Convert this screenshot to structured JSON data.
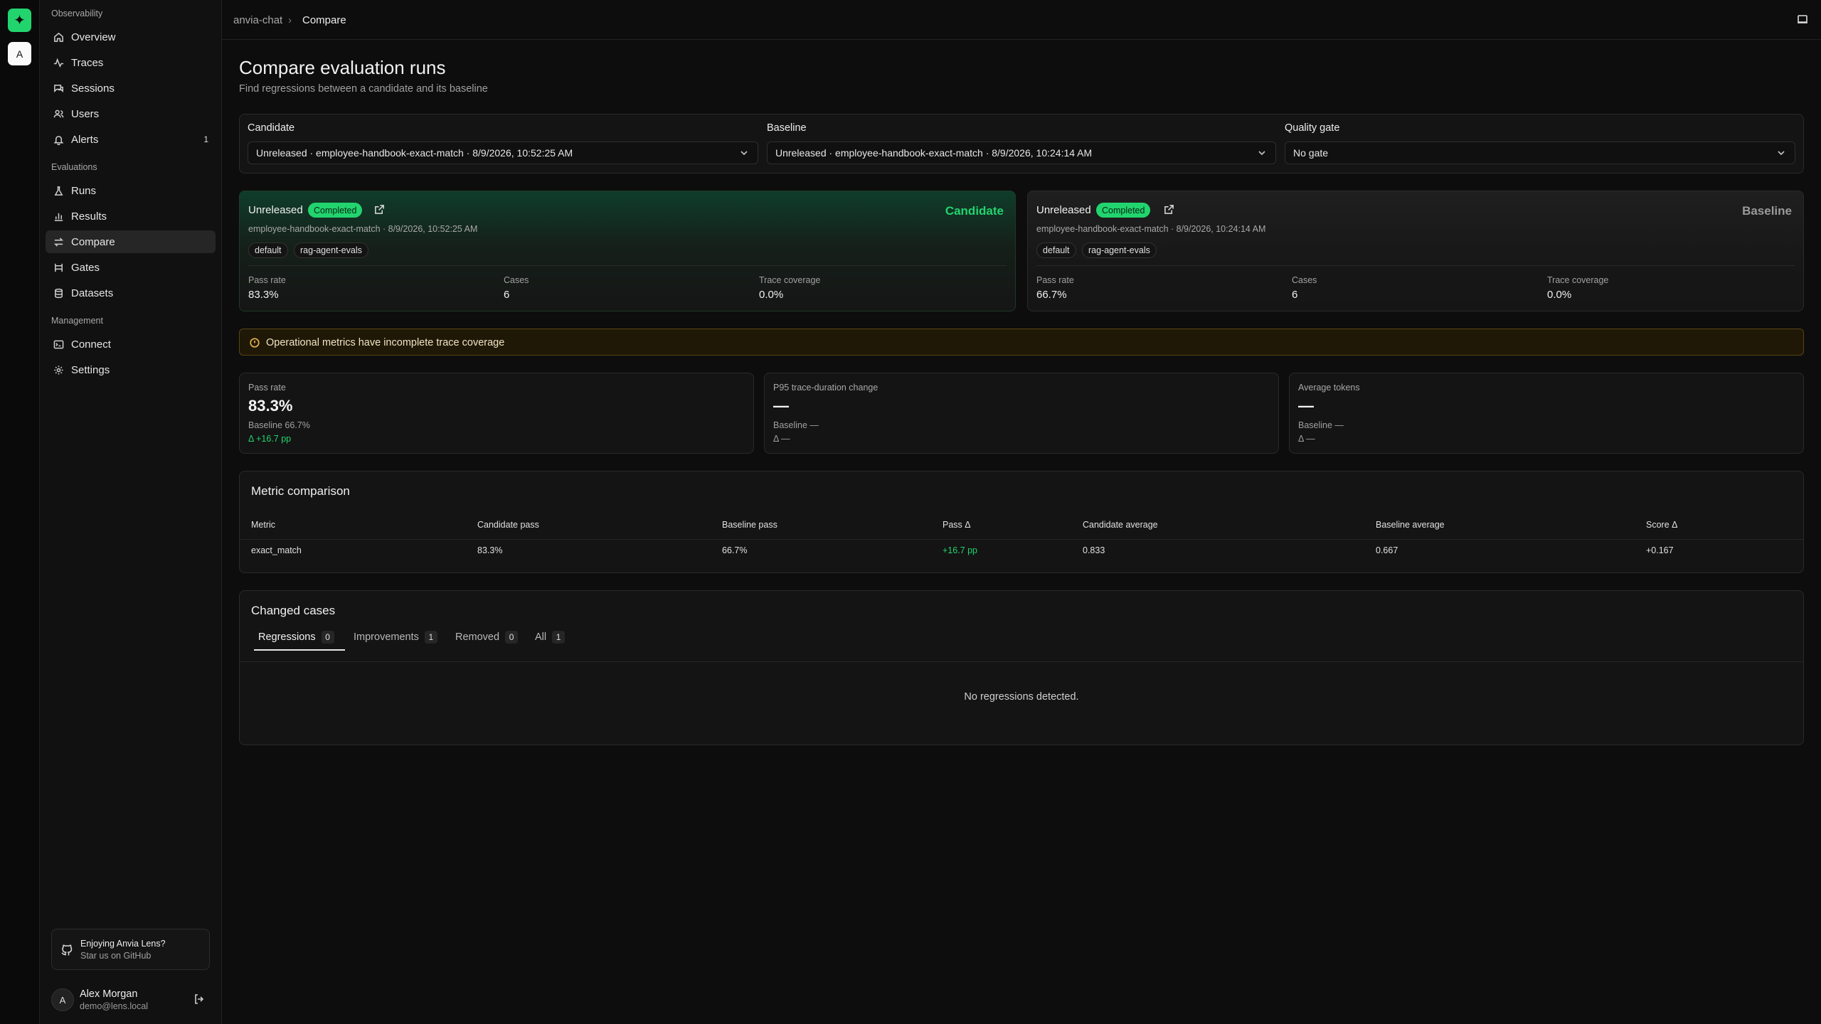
{
  "app": {
    "logo_glyph": "✦",
    "workspace_initial": "A",
    "accent": "#22d46e"
  },
  "sidebar": {
    "groups": [
      {
        "label": "Observability"
      },
      {
        "label": "Evaluations"
      },
      {
        "label": "Management"
      }
    ],
    "items": [
      {
        "label": "Overview",
        "icon": "home-icon"
      },
      {
        "label": "Traces",
        "icon": "activity-icon"
      },
      {
        "label": "Sessions",
        "icon": "chat-icon"
      },
      {
        "label": "Users",
        "icon": "users-icon"
      },
      {
        "label": "Alerts",
        "icon": "bell-icon",
        "count": "1"
      },
      {
        "label": "Runs",
        "icon": "flask-icon"
      },
      {
        "label": "Results",
        "icon": "bar-chart-icon"
      },
      {
        "label": "Compare",
        "icon": "compare-icon",
        "active": true
      },
      {
        "label": "Gates",
        "icon": "gate-icon"
      },
      {
        "label": "Datasets",
        "icon": "database-icon"
      },
      {
        "label": "Connect",
        "icon": "terminal-icon"
      },
      {
        "label": "Settings",
        "icon": "gear-icon"
      }
    ],
    "promo": {
      "title": "Enjoying Anvia Lens?",
      "subtitle": "Star us on GitHub"
    },
    "user": {
      "initial": "A",
      "name": "Alex Morgan",
      "email": "demo@lens.local"
    }
  },
  "breadcrumb": {
    "project": "anvia-chat",
    "separator": "›",
    "page": "Compare"
  },
  "page": {
    "title": "Compare evaluation runs",
    "subtitle": "Find regressions between a candidate and its baseline"
  },
  "selectors": {
    "candidate": {
      "label": "Candidate",
      "value": "Unreleased · employee-handbook-exact-match · 8/9/2026, 10:52:25 AM"
    },
    "baseline": {
      "label": "Baseline",
      "value": "Unreleased · employee-handbook-exact-match · 8/9/2026, 10:24:14 AM"
    },
    "gate": {
      "label": "Quality gate",
      "value": "No gate"
    }
  },
  "candidate_card": {
    "title": "Unreleased",
    "status": "Completed",
    "role": "Candidate",
    "role_color": "#22d46e",
    "meta": "employee-handbook-exact-match · 8/9/2026, 10:52:25 AM",
    "tags": [
      "default",
      "rag-agent-evals"
    ],
    "stats": [
      {
        "label": "Pass rate",
        "value": "83.3%"
      },
      {
        "label": "Cases",
        "value": "6"
      },
      {
        "label": "Trace coverage",
        "value": "0.0%"
      }
    ]
  },
  "baseline_card": {
    "title": "Unreleased",
    "status": "Completed",
    "role": "Baseline",
    "role_color": "#9a9a9a",
    "meta": "employee-handbook-exact-match · 8/9/2026, 10:24:14 AM",
    "tags": [
      "default",
      "rag-agent-evals"
    ],
    "stats": [
      {
        "label": "Pass rate",
        "value": "66.7%"
      },
      {
        "label": "Cases",
        "value": "6"
      },
      {
        "label": "Trace coverage",
        "value": "0.0%"
      }
    ]
  },
  "warning": {
    "text": "Operational metrics have incomplete trace coverage",
    "color": "#e2b04a"
  },
  "kpis": [
    {
      "label": "Pass rate",
      "value": "83.3%",
      "baseline": "Baseline 66.7%",
      "delta": "Δ +16.7 pp"
    },
    {
      "label": "P95 trace-duration change",
      "value": "—",
      "baseline": "Baseline —",
      "delta": "Δ —"
    },
    {
      "label": "Average tokens",
      "value": "—",
      "baseline": "Baseline —",
      "delta": "Δ —"
    }
  ],
  "metric_comparison": {
    "title": "Metric comparison",
    "columns": [
      "Metric",
      "Candidate pass",
      "Baseline pass",
      "Pass Δ",
      "Candidate average",
      "Baseline average",
      "Score Δ"
    ],
    "rows": [
      [
        "exact_match",
        "83.3%",
        "66.7%",
        "+16.7 pp",
        "0.833",
        "0.667",
        "+0.167"
      ]
    ]
  },
  "changed_cases": {
    "title": "Changed cases",
    "tabs": [
      {
        "label": "Regressions",
        "count": "0"
      },
      {
        "label": "Improvements",
        "count": "1"
      },
      {
        "label": "Removed",
        "count": "0"
      },
      {
        "label": "All",
        "count": "1"
      }
    ],
    "empty_text": "No regressions detected."
  }
}
